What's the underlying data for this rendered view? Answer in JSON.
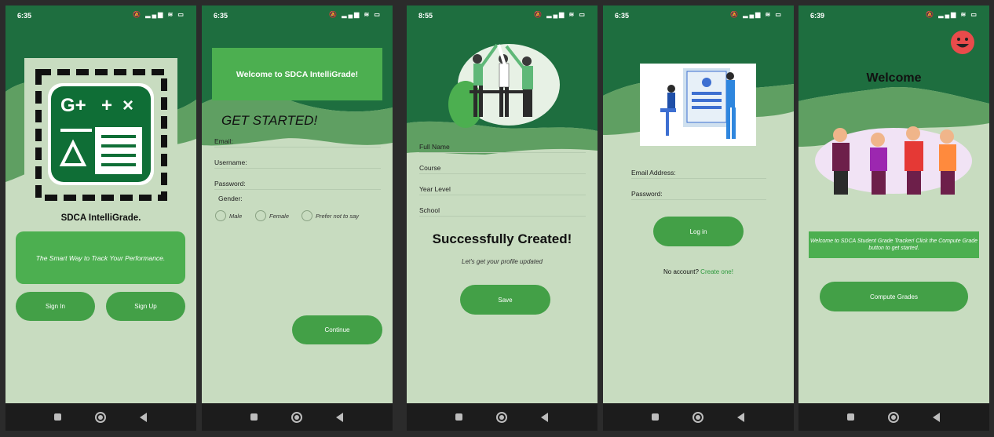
{
  "screens": [
    {
      "status_time": "6:35"
    },
    {
      "status_time": "6:35"
    },
    {
      "status_time": "8:55"
    },
    {
      "status_time": "6:35"
    },
    {
      "status_time": "6:39"
    }
  ],
  "status_icons": "🔕 ▂▄▆ ≋ ▭",
  "splash": {
    "app_name": "SDCA IntelliGrade.",
    "tagline": "The Smart Way to Track Your Performance.",
    "signin_label": "Sign In",
    "signup_label": "Sign Up",
    "logo_text": "G++x"
  },
  "register": {
    "banner_title": "Welcome to SDCA IntelliGrade!",
    "heading": "GET STARTED!",
    "email_label": "Email:",
    "username_label": "Username:",
    "password_label": "Password:",
    "gender_label": "Gender:",
    "gender_options": [
      "Male",
      "Female",
      "Prefer not to say"
    ],
    "continue_label": "Continue"
  },
  "profile": {
    "fields": [
      "Full Name",
      "Course",
      "Year Level",
      "School"
    ],
    "success_title": "Successfully Created!",
    "subtitle": "Let's get your profile updated",
    "save_label": "Save"
  },
  "login": {
    "email_label": "Email Address:",
    "password_label": "Password:",
    "login_label": "Log in",
    "no_account": "No account?",
    "create_link": "Create one!"
  },
  "welcome": {
    "title": "Welcome",
    "message": "Welcome to SDCA Student Grade Tracker! Click the Compute Grade button to get started.",
    "compute_label": "Compute Grades"
  },
  "colors": {
    "dark_green": "#1e6e3f",
    "mid_green": "#5f9f62",
    "button_green": "#43a047",
    "pale_green": "#c8dcc0",
    "link_green": "#2e9a3e",
    "emoji_red": "#e94b4b"
  }
}
